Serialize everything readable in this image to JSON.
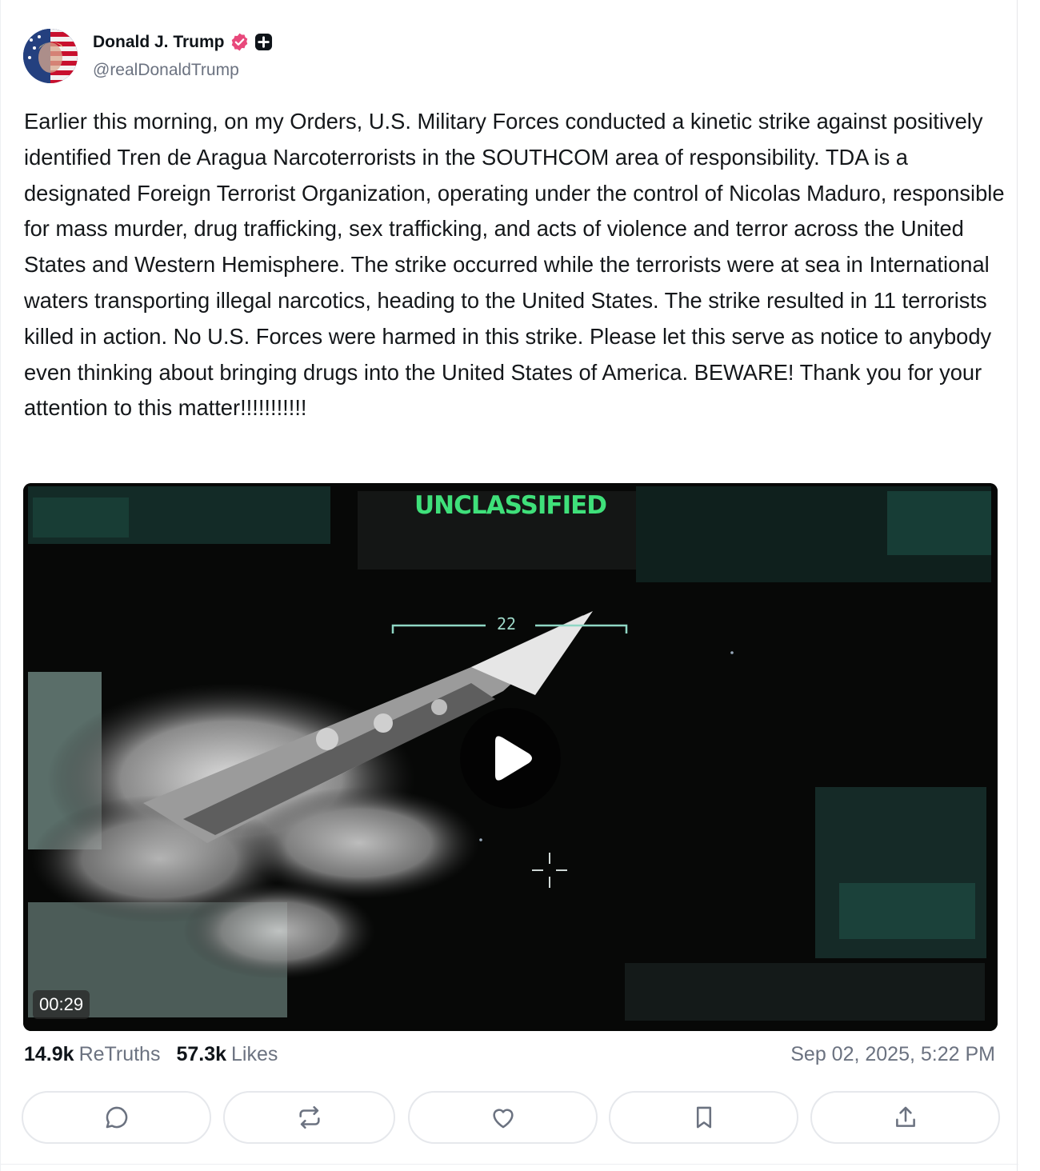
{
  "author": {
    "display_name": "Donald J. Trump",
    "handle": "@realDonaldTrump",
    "verified_color": "#e8487b"
  },
  "post": {
    "text": "Earlier this morning, on my Orders, U.S. Military Forces conducted a kinetic strike against positively identified Tren de Aragua Narcoterrorists in the SOUTHCOM area of responsibility. TDA is a designated Foreign Terrorist Organization, operating under the control of Nicolas Maduro, responsible for mass murder, drug trafficking, sex trafficking, and acts of violence and terror across the United States and Western Hemisphere. The strike occurred while the terrorists were at sea in International waters transporting illegal narcotics, heading to the United States. The strike resulted in 11 terrorists killed in action. No U.S. Forces were harmed in this strike. Please let this serve as notice to anybody even thinking about bringing drugs into the United States of America. BEWARE! Thank you for your attention to this matter!!!!!!!!!!!"
  },
  "video": {
    "classification": "UNCLASSIFIED",
    "reticle_range": "22",
    "duration": "00:29",
    "overlay_text_color": "#3fe07a"
  },
  "stats": {
    "retruths_count": "14.9k",
    "retruths_label": "ReTruths",
    "likes_count": "57.3k",
    "likes_label": "Likes",
    "timestamp": "Sep 02, 2025, 5:22 PM"
  },
  "actions": [
    {
      "icon": "reply-icon"
    },
    {
      "icon": "retruth-icon"
    },
    {
      "icon": "like-icon"
    },
    {
      "icon": "bookmark-icon"
    },
    {
      "icon": "share-icon"
    }
  ]
}
